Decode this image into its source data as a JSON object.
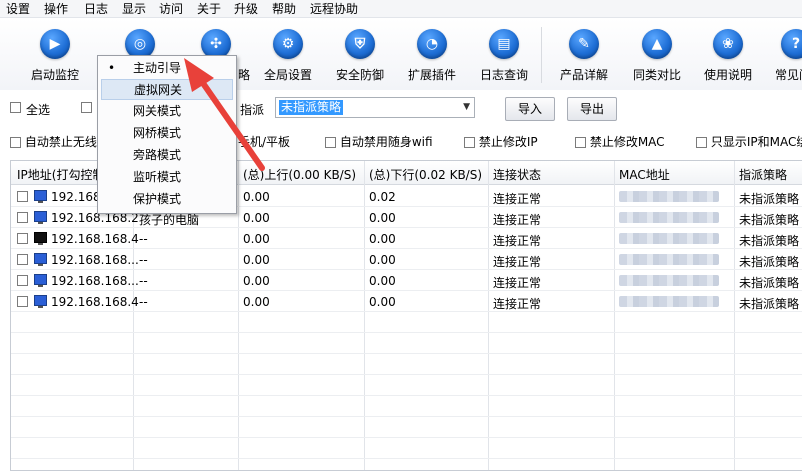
{
  "menu": [
    "设置",
    "操作",
    "日志",
    "显示",
    "访问",
    "关于",
    "升级",
    "帮助",
    "远程协助"
  ],
  "toolbar": [
    {
      "label": "启动监控",
      "icon": "play-icon"
    },
    {
      "label": "",
      "icon": "search-icon"
    },
    {
      "label": "",
      "icon": "network-icon"
    },
    {
      "label": "全局设置",
      "icon": "gear-icon"
    },
    {
      "label": "安全防御",
      "icon": "shield-icon"
    },
    {
      "label": "扩展插件",
      "icon": "plugin-icon"
    },
    {
      "label": "日志查询",
      "icon": "log-icon"
    },
    {
      "label": "产品详解",
      "icon": "edit-icon"
    },
    {
      "label": "同类对比",
      "icon": "graduation-cap-icon"
    },
    {
      "label": "使用说明",
      "icon": "ribbon-icon"
    },
    {
      "label": "常见问",
      "icon": "question-icon"
    }
  ],
  "row1": {
    "select_all": "全选",
    "assign_label": "指派",
    "strategy_selected": "未指派策略",
    "import": "导入",
    "export": "导出"
  },
  "row2": {
    "auto_block_wireless": "自动禁止无线",
    "phone_tablet": "手机/平板",
    "auto_block_wifi": "自动禁用随身wifi",
    "forbid_ip": "禁止修改IP",
    "forbid_mac": "禁止修改MAC",
    "only_show_ip_mac": "只显示IP和MAC绑"
  },
  "table": {
    "headers": [
      "IP地址(打勾控制",
      "",
      "(总)上行(0.00 KB/S)",
      "(总)下行(0.02 KB/S)",
      "连接状态",
      "MAC地址",
      "指派策略"
    ],
    "rows": [
      {
        "ip": "192.168.",
        "name": "",
        "up": "0.00",
        "down": "0.02",
        "status": "连接正常",
        "policy": "未指派策略",
        "dark": false
      },
      {
        "ip": "192.168.168.2",
        "name": "孩子的电脑",
        "up": "0.00",
        "down": "0.00",
        "status": "连接正常",
        "policy": "未指派策略",
        "dark": false
      },
      {
        "ip": "192.168.168.4",
        "name": "--",
        "up": "0.00",
        "down": "0.00",
        "status": "连接正常",
        "policy": "未指派策略",
        "dark": true
      },
      {
        "ip": "192.168.168...",
        "name": "--",
        "up": "0.00",
        "down": "0.00",
        "status": "连接正常",
        "policy": "未指派策略",
        "dark": false
      },
      {
        "ip": "192.168.168...",
        "name": "--",
        "up": "0.00",
        "down": "0.00",
        "status": "连接正常",
        "policy": "未指派策略",
        "dark": false
      },
      {
        "ip": "192.168.168.4",
        "name": "--",
        "up": "0.00",
        "down": "0.00",
        "status": "连接正常",
        "policy": "未指派策略",
        "dark": false
      }
    ]
  },
  "popup": {
    "items": [
      "主动引导",
      "虚拟网关",
      "网关模式",
      "网桥模式",
      "旁路模式",
      "监听模式",
      "保护模式"
    ],
    "selected": "•"
  },
  "colors": {
    "accent": "#3399ff",
    "arrow": "#e8413a",
    "icon_blue": "#1f6fd6"
  }
}
